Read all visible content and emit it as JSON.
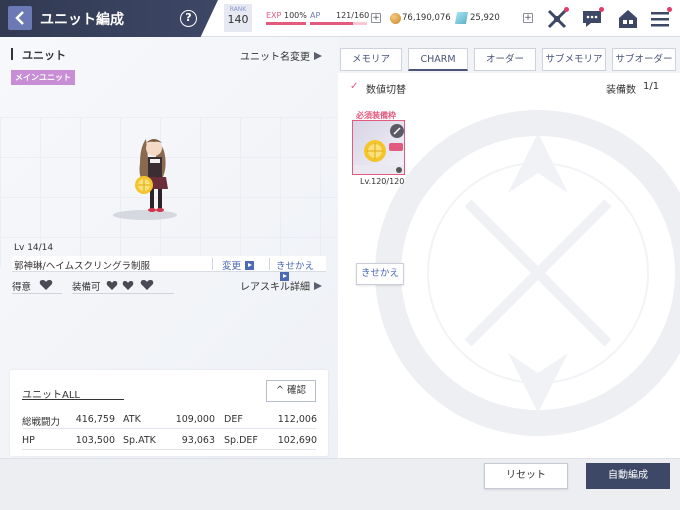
{
  "header": {
    "title": "ユニット編成",
    "help": "?",
    "rank_label": "RANK",
    "rank_value": "140",
    "exp_label": "EXP",
    "exp_value": "100%",
    "exp_fraction": 1.0,
    "ap_label": "AP",
    "ap_value": "121/160",
    "ap_fraction": 0.756,
    "coins": "76,190,076",
    "gems": "25,920",
    "plus": "+",
    "icons": [
      "battle-icon",
      "chat-icon",
      "home-icon",
      "menu-icon"
    ]
  },
  "left": {
    "section_title": "ユニット",
    "rename": "ユニット名変更",
    "main_badge": "メインユニット",
    "level": "Lv  14/14",
    "costume_name": "郭神琳/ヘイムスクリングラ制服",
    "change": "変更",
    "dress": "きせかえ",
    "tokui": "得意",
    "soubi": "装備可",
    "rare_skill": "レアスキル詳細",
    "stats": {
      "title": "ユニットALL",
      "confirm": "確認",
      "rows": [
        [
          {
            "label": "総戦闘力",
            "value": "416,759"
          },
          {
            "label": "ATK",
            "value": "109,000"
          },
          {
            "label": "DEF",
            "value": "112,006"
          }
        ],
        [
          {
            "label": "HP",
            "value": "103,500"
          },
          {
            "label": "Sp.ATK",
            "value": "93,063"
          },
          {
            "label": "Sp.DEF",
            "value": "102,690"
          }
        ]
      ]
    }
  },
  "right": {
    "tabs": [
      "メモリア",
      "CHARM",
      "オーダー",
      "サブメモリア",
      "サブオーダー"
    ],
    "active_tab": 1,
    "toggle_label": "数値切替",
    "count_label": "装備数",
    "count_value": "1/1",
    "hissu": "必須装備枠",
    "charm_level": "Lv.120/120",
    "kisekae": "きせかえ"
  },
  "footer": {
    "reset": "リセット",
    "auto": "自動編成"
  },
  "colors": {
    "header_dark": "#323a52",
    "accent_pink": "#e25a7e",
    "accent_blue": "#4d6ab5",
    "badge_purple": "#c78ed6"
  }
}
